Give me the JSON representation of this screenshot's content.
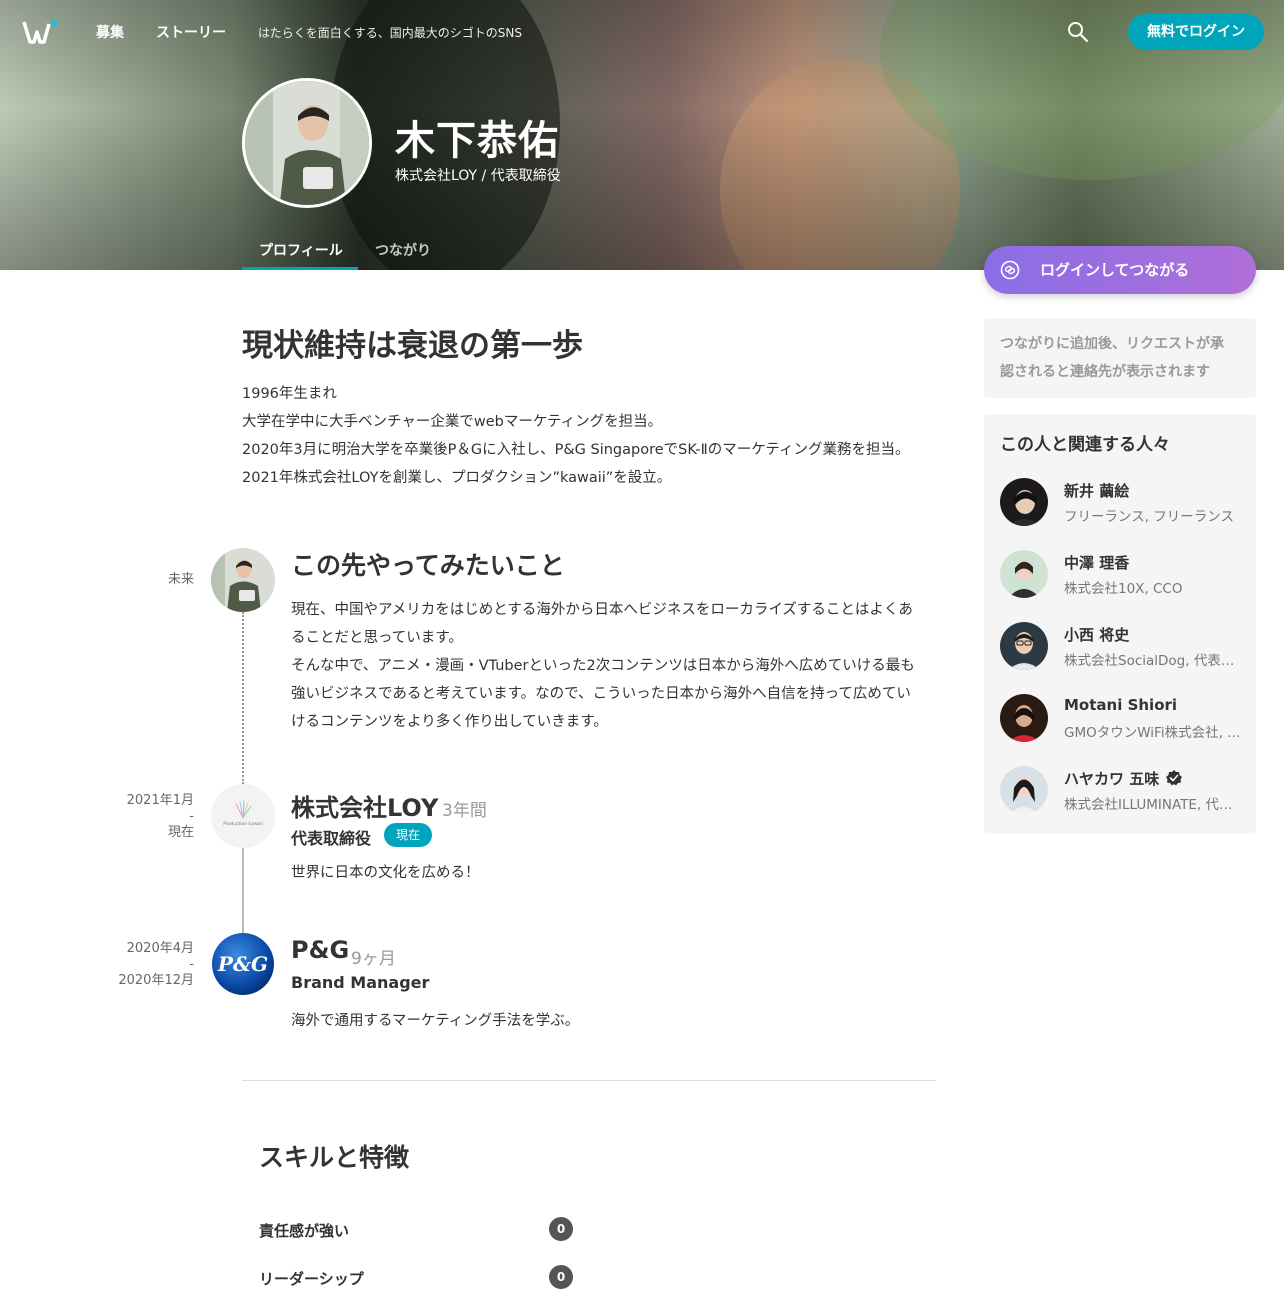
{
  "header": {
    "nav": {
      "recruit": "募集",
      "story": "ストーリー"
    },
    "tagline": "はたらくを面白くする、国内最大のシゴトのSNS",
    "login_label": "無料でログイン",
    "accent_color": "#00a4bb"
  },
  "profile": {
    "name": "木下恭佑",
    "title": "株式会社LOY / 代表取締役",
    "tabs": [
      {
        "label": "プロフィール",
        "active": true
      },
      {
        "label": "つながり",
        "active": false
      }
    ]
  },
  "main": {
    "headline": "現状維持は衰退の第一歩",
    "bio": [
      "1996年生まれ",
      "大学在学中に大手ベンチャー企業でwebマーケティングを担当。",
      "2020年3月に明治大学を卒業後P＆Gに入社し、P&G SingaporeでSK-Ⅱのマーケティング業務を担当。",
      "2021年株式会社LOYを創業し、プロダクション”kawaii”を設立。"
    ],
    "future": {
      "date": "未来",
      "title": "この先やってみたいこと",
      "text_lines": [
        "現在、中国やアメリカをはじめとする海外から日本へビジネスをローカライズすることはよくあ",
        "ることだと思っています。",
        "そんな中で、アニメ・漫画・VTuberといった2次コンテンツは日本から海外へ広めていける最も",
        "強いビジネスであると考えています。なので、こういった日本から海外へ自信を持って広めてい",
        "けるコンテンツをより多く作り出していきます。"
      ]
    },
    "jobs": [
      {
        "date_start": "2021年1月",
        "date_sep": "-",
        "date_end": "現在",
        "company": "株式会社LOY",
        "duration": "3年間",
        "role": "代表取締役",
        "badge": "現在",
        "description": "世界に日本の文化を広める！",
        "logo_text": "Production kawaii"
      },
      {
        "date_start": "2020年4月",
        "date_sep": "-",
        "date_end": "2020年12月",
        "company": "P&G",
        "duration": "9ヶ月",
        "role": "Brand Manager",
        "description": "海外で通用するマーケティング手法を学ぶ。",
        "logo_text": "P&G"
      }
    ],
    "skills": {
      "title": "スキルと特徴",
      "items": [
        {
          "label": "責任感が強い",
          "count": "0"
        },
        {
          "label": "リーダーシップ",
          "count": "0"
        }
      ]
    }
  },
  "sidebar": {
    "connect_label": "ログインしてつながる",
    "notice_lines": [
      "つながりに追加後、リクエストが承",
      "認されると連絡先が表示されます"
    ],
    "related_title": "この人と関連する人々",
    "people": [
      {
        "name": "新井 繭絵",
        "sub": "フリーランス, フリーランス"
      },
      {
        "name": "中澤 理香",
        "sub": "株式会社10X, CCO"
      },
      {
        "name": "小西 将史",
        "sub": "株式会社SocialDog, 代表取締役"
      },
      {
        "name": "Motani Shiori",
        "sub": "GMOタウンWiFi株式会社, 広報"
      },
      {
        "name": "ハヤカワ 五味",
        "sub": "株式会社ILLUMINATE, 代表取締役",
        "verified": true
      }
    ]
  }
}
